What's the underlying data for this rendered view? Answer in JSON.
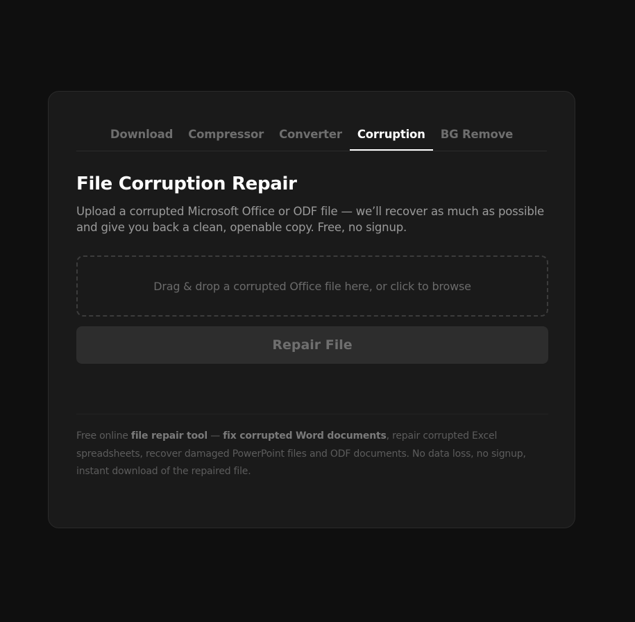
{
  "tabs": [
    {
      "label": "Download",
      "active": false
    },
    {
      "label": "Compressor",
      "active": false
    },
    {
      "label": "Converter",
      "active": false
    },
    {
      "label": "Corruption",
      "active": true
    },
    {
      "label": "BG Remove",
      "active": false
    }
  ],
  "main": {
    "title": "File Corruption Repair",
    "subtitle": "Upload a corrupted Microsoft Office or ODF file — we’ll recover as much as possible and give you back a clean, openable copy. Free, no signup.",
    "dropzone_text": "Drag & drop a corrupted Office file here, or click to browse",
    "repair_button_label": "Repair File"
  },
  "footer": {
    "part1": "Free online ",
    "bold1": "file repair tool",
    "part2": " — ",
    "bold2": "fix corrupted Word documents",
    "part3": ", repair corrupted Excel spreadsheets, recover damaged PowerPoint files and ODF documents. No data loss, no signup, instant download of the repaired file."
  },
  "colors": {
    "background": "#0f0f0f",
    "card": "#1a1a1a",
    "active_tab": "#ffffff",
    "inactive_tab": "#6e6e6e",
    "button_disabled": "#2d2d2d"
  }
}
